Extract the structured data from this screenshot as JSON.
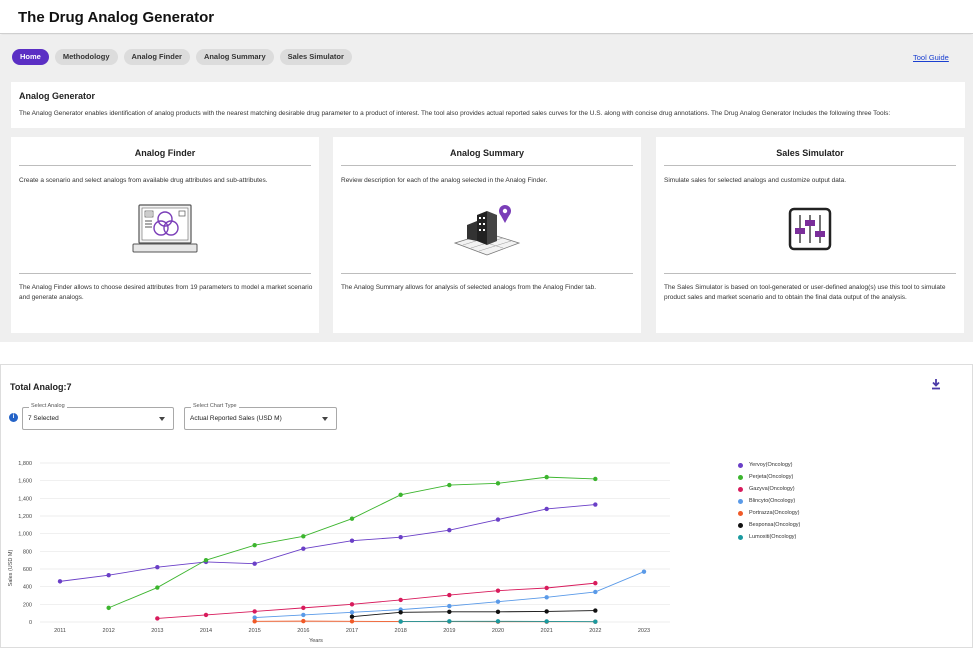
{
  "app": {
    "title": "The Drug Analog Generator"
  },
  "nav": {
    "tabs": [
      {
        "label": "Home"
      },
      {
        "label": "Methodology"
      },
      {
        "label": "Analog Finder"
      },
      {
        "label": "Analog Summary"
      },
      {
        "label": "Sales Simulator"
      }
    ],
    "tool_guide": "Tool Guide"
  },
  "generator": {
    "title": "Analog Generator",
    "description": "The Analog Generator enables identification of analog products with the nearest matching desirable drug parameter to a product of interest. The tool also provides actual reported sales curves for the U.S. along with concise drug annotations. The Drug Analog Generator Includes the following three Tools:"
  },
  "cards": [
    {
      "title": "Analog Finder",
      "desc": "Create a scenario and select analogs from available drug attributes and sub-attributes.",
      "long": "The Analog Finder allows to choose desired attributes from 19 parameters to model a market scenario and generate analogs.",
      "icon": "laptop-venn-icon"
    },
    {
      "title": "Analog Summary",
      "desc": "Review description for each of the analog selected in the Analog Finder.",
      "long": "The Analog Summary allows for analysis of selected analogs from the Analog Finder tab.",
      "icon": "building-pin-icon"
    },
    {
      "title": "Sales Simulator",
      "desc": "Simulate sales for selected analogs and customize output data.",
      "long": "The Sales Simulator is based on tool-generated or user-defined analog(s) use this tool to simulate product sales and market scenario and to obtain the final data output of the analysis.",
      "icon": "sliders-icon"
    }
  ],
  "analysis": {
    "total": "Total Analog:7",
    "select_analog": {
      "label": "Select Analog",
      "value": "7 Selected"
    },
    "select_chart": {
      "label": "Select Chart Type",
      "value": "Actual Reported Sales (USD M)"
    }
  },
  "colors": {
    "accent": "#5b2fc4"
  },
  "chart_data": {
    "type": "line",
    "xlabel": "Years",
    "ylabel": "Sales (USD M)",
    "x": [
      2011,
      2012,
      2013,
      2014,
      2015,
      2016,
      2017,
      2018,
      2019,
      2020,
      2021,
      2022,
      2023
    ],
    "yticks": [
      0,
      200,
      400,
      600,
      800,
      1000,
      1200,
      1400,
      1600,
      1800
    ],
    "yticklabels": [
      "0",
      "200",
      "400",
      "600",
      "800",
      "1,000",
      "1,200",
      "1,400",
      "1,600",
      "1,800"
    ],
    "ylim": [
      0,
      1800
    ],
    "grid": true,
    "legend_position": "right",
    "series": [
      {
        "name": "Yervoy(Oncology)",
        "color": "#6a3fc7",
        "points": [
          [
            2011,
            460
          ],
          [
            2012,
            530
          ],
          [
            2013,
            620
          ],
          [
            2014,
            680
          ],
          [
            2015,
            660
          ],
          [
            2016,
            830
          ],
          [
            2017,
            920
          ],
          [
            2018,
            960
          ],
          [
            2019,
            1040
          ],
          [
            2020,
            1160
          ],
          [
            2021,
            1280
          ],
          [
            2022,
            1330
          ]
        ]
      },
      {
        "name": "Perjeta(Oncology)",
        "color": "#3cb52e",
        "points": [
          [
            2012,
            160
          ],
          [
            2013,
            390
          ],
          [
            2014,
            700
          ],
          [
            2015,
            870
          ],
          [
            2016,
            970
          ],
          [
            2017,
            1170
          ],
          [
            2018,
            1440
          ],
          [
            2019,
            1550
          ],
          [
            2020,
            1570
          ],
          [
            2021,
            1640
          ],
          [
            2022,
            1620
          ]
        ]
      },
      {
        "name": "Gazyva(Oncology)",
        "color": "#d81b5c",
        "points": [
          [
            2013,
            40
          ],
          [
            2014,
            80
          ],
          [
            2015,
            120
          ],
          [
            2016,
            160
          ],
          [
            2017,
            200
          ],
          [
            2018,
            250
          ],
          [
            2019,
            305
          ],
          [
            2020,
            355
          ],
          [
            2021,
            385
          ],
          [
            2022,
            440
          ]
        ]
      },
      {
        "name": "Blincyto(Oncology)",
        "color": "#5a9ae8",
        "points": [
          [
            2015,
            50
          ],
          [
            2016,
            80
          ],
          [
            2017,
            110
          ],
          [
            2018,
            140
          ],
          [
            2019,
            180
          ],
          [
            2020,
            230
          ],
          [
            2021,
            280
          ],
          [
            2022,
            340
          ],
          [
            2023,
            570
          ]
        ]
      },
      {
        "name": "Portrazza(Oncology)",
        "color": "#f05a28",
        "points": [
          [
            2015,
            8
          ],
          [
            2016,
            10
          ],
          [
            2017,
            8
          ],
          [
            2018,
            6
          ],
          [
            2019,
            5
          ],
          [
            2020,
            4
          ],
          [
            2021,
            3
          ],
          [
            2022,
            3
          ]
        ]
      },
      {
        "name": "Besponsa(Oncology)",
        "color": "#111111",
        "points": [
          [
            2017,
            60
          ],
          [
            2018,
            110
          ],
          [
            2019,
            115
          ],
          [
            2020,
            115
          ],
          [
            2021,
            120
          ],
          [
            2022,
            130
          ]
        ]
      },
      {
        "name": "Lumoxiti(Oncology)",
        "color": "#1a9aa0",
        "points": [
          [
            2018,
            5
          ],
          [
            2019,
            8
          ],
          [
            2020,
            8
          ],
          [
            2021,
            6
          ],
          [
            2022,
            4
          ]
        ]
      }
    ]
  }
}
